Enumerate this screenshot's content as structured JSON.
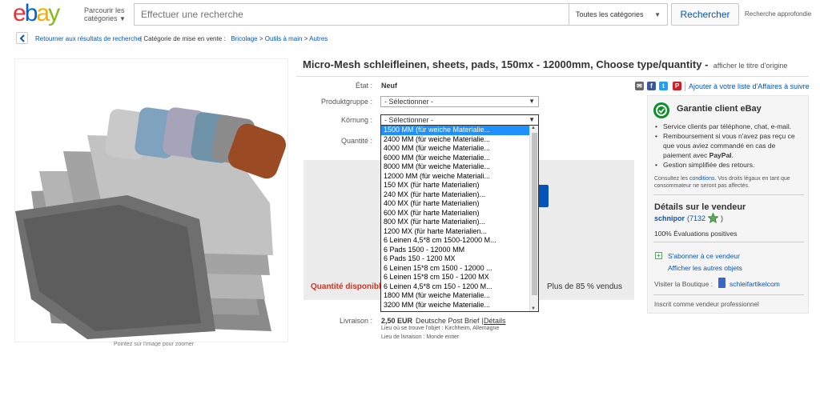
{
  "header": {
    "logo_letters": [
      "e",
      "b",
      "a",
      "y"
    ],
    "logo_colors": [
      "#e53238",
      "#0064d2",
      "#f5af02",
      "#86b817"
    ],
    "browse_line1": "Parcourir les",
    "browse_line2": "catégories",
    "search_placeholder": "Effectuer une recherche",
    "category_value": "Toutes les catégories",
    "search_button": "Rechercher",
    "advanced_search": "Recherche approfondie"
  },
  "breadcrumb": {
    "back": "Retourner aux résultats de recherche",
    "sep": "|",
    "category_label": "Catégorie de mise en vente :",
    "crumbs": [
      "Bricolage",
      ">",
      "Outils à main",
      ">",
      "Autres"
    ]
  },
  "image": {
    "hover_hint": "Pointez sur l'image pour zoomer"
  },
  "listing": {
    "title": "Micro-Mesh schleifleinen, sheets, pads, 150mx - 12000mm, Choose type/quantity -",
    "original_title_link": "afficher le titre d'origine",
    "state_label": "État :",
    "state_value": "Neuf",
    "produktgruppe_label": "Produktgruppe :",
    "produktgruppe_value": "- Sélectionner -",
    "kornung_label": "Körnung :",
    "kornung_value": "- Sélectionner -",
    "quantity_label": "Quantité :",
    "quantity_available": "Quantité disponible",
    "sold_percent": "Plus de 85 % vendus"
  },
  "dropdown_options": [
    "1500 MM (für weiche Materialie...",
    "2400 MM (für weiche Materialie...",
    "4000 MM (für weiche Materialie...",
    "6000 MM (für weiche Materialie...",
    "8000 MM (für weiche Materialie...",
    "12000 MM (für weiche Materiali...",
    "150 MX (für harte Materialien)",
    "240 MX (für harte Materialien)...",
    "400 MX (für harte Materialien)",
    "600 MX (für harte Materialien)",
    "800 MX (für harte Materialien)...",
    "1200 MX (für harte Materialien...",
    "6 Leinen 4,5*8 cm 1500-12000 M...",
    "6 Pads 1500 - 12000 MM",
    "6 Pads 150 - 1200 MX",
    "6 Leinen 15*8 cm 1500 - 12000 ...",
    "6 Leinen 15*8 cm 150 - 1200 MX",
    "6 Leinen 4,5*8 cm 150 - 1200 M...",
    "1800 MM (für weiche Materialie...",
    "3200 MM (für weiche Materialie..."
  ],
  "shipping": {
    "label": "Livraison :",
    "price": "2,50 EUR",
    "method": "Deutsche Post Brief",
    "sep": "|",
    "details": "Détails",
    "location": "Lieu où se trouve l'objet :   Kirchheim, Allemagne",
    "delivery": "Lieu de livraison :   Monde entier"
  },
  "share": {
    "icons": [
      "mail-icon",
      "facebook-icon",
      "twitter-icon",
      "pinterest-icon"
    ],
    "watch": "Ajouter à votre liste d'Affaires à suivre",
    "sep": "|"
  },
  "guarantee": {
    "title": "Garantie client eBay",
    "b1": "Service clients par téléphone, chat, e-mail.",
    "b2_a": "Remboursement si vous n'avez pas reçu ce que vous aviez commandé en cas de paiement avec ",
    "b2_b": "PayPal",
    "b2_c": ".",
    "b3": "Gestion simplifiée des retours.",
    "fine_a": "Consultez les ",
    "fine_link": "conditions",
    "fine_b": ". Vos droits légaux en tant que consommateur ne seront pas affectés."
  },
  "seller": {
    "title": "Détails sur le vendeur",
    "name": "schnipor",
    "feedback": "(7132",
    "close": ")",
    "positive": "100% Évaluations positives",
    "subscribe": "S'abonner à ce vendeur",
    "other_items": "Afficher les autres objets",
    "shop_label": "Visiter la Boutique :",
    "shop_name": "schleifartikelcom",
    "pro": "Inscrit comme vendeur professionnel"
  }
}
